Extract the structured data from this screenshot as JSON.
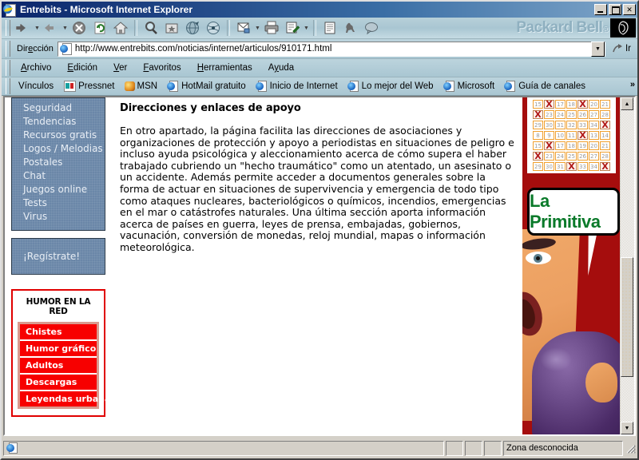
{
  "window": {
    "title": "Entrebits - Microsoft Internet Explorer",
    "app_icon": "ie-document-icon",
    "minimize_label": "",
    "maximize_label": "",
    "close_label": "✕"
  },
  "toolbar": {
    "buttons": [
      {
        "name": "back-button",
        "label": "Atrás",
        "icon": "arrow-left-icon"
      },
      {
        "name": "forward-button",
        "label": "Adelante",
        "icon": "arrow-right-icon"
      },
      {
        "name": "stop-button",
        "label": "Detener",
        "icon": "stop-icon"
      },
      {
        "name": "refresh-button",
        "label": "Actualizar",
        "icon": "refresh-icon"
      },
      {
        "name": "home-button",
        "label": "Inicio",
        "icon": "home-icon"
      },
      {
        "name": "search-button",
        "label": "Búsqueda",
        "icon": "magnifier-icon"
      },
      {
        "name": "favorites-button",
        "label": "Favoritos",
        "icon": "favorites-folder-icon"
      },
      {
        "name": "history-button",
        "label": "Historial",
        "icon": "history-globe-icon"
      },
      {
        "name": "channels-button",
        "label": "Canales",
        "icon": "channels-globe-icon"
      },
      {
        "name": "mail-button",
        "label": "Correo",
        "icon": "mail-icon"
      },
      {
        "name": "print-button",
        "label": "Imprimir",
        "icon": "printer-icon"
      },
      {
        "name": "edit-button",
        "label": "Modificar",
        "icon": "edit-page-icon"
      },
      {
        "name": "discuss-button",
        "label": "Discusión",
        "icon": "document-icon"
      },
      {
        "name": "messenger-button",
        "label": "Messenger",
        "icon": "kangaroo-icon"
      },
      {
        "name": "chat-button",
        "label": "Chat",
        "icon": "speech-bubble-icon"
      }
    ],
    "brand": "Packard Bell",
    "brand_mark": "®",
    "brand_logo": "packard-bell-head-logo"
  },
  "address": {
    "label_pre": "Dir",
    "label_accel": "e",
    "label_post": "cción",
    "url": "http://www.entrebits.com/noticias/internet/articulos/910171.html",
    "placeholder": "",
    "go_label": "Ir",
    "go_icon": "go-arrow-icon",
    "dropdown_icon": "chevron-down-icon",
    "page_icon": "ie-page-icon"
  },
  "menu": {
    "items": [
      {
        "pre": "",
        "accel": "A",
        "post": "rchivo"
      },
      {
        "pre": "",
        "accel": "E",
        "post": "dición"
      },
      {
        "pre": "",
        "accel": "V",
        "post": "er"
      },
      {
        "pre": "",
        "accel": "F",
        "post": "avoritos"
      },
      {
        "pre": "",
        "accel": "H",
        "post": "erramientas"
      },
      {
        "pre": "A",
        "accel": "y",
        "post": "uda"
      }
    ]
  },
  "links_bar": {
    "label": "Vínculos",
    "overflow": "»",
    "items": [
      {
        "label": "Pressnet",
        "icon": "pressnet-icon"
      },
      {
        "label": "MSN",
        "icon": "msn-butterfly-icon"
      },
      {
        "label": "HotMail gratuito",
        "icon": "ie-page-icon"
      },
      {
        "label": "Inicio de Internet",
        "icon": "ie-page-icon"
      },
      {
        "label": "Lo mejor del Web",
        "icon": "ie-page-icon"
      },
      {
        "label": "Microsoft",
        "icon": "ie-page-icon"
      },
      {
        "label": "Guía de canales",
        "icon": "ie-page-icon"
      }
    ]
  },
  "sidebar": {
    "nav_items": [
      {
        "label": "Seguridad"
      },
      {
        "label": "Tendencias"
      },
      {
        "label": "Recursos gratis"
      },
      {
        "label": "Logos / Melodias"
      },
      {
        "label": "Postales"
      },
      {
        "label": "Chat"
      },
      {
        "label": "Juegos online"
      },
      {
        "label": "Tests"
      },
      {
        "label": "Virus"
      }
    ],
    "register_label": "¡Regístrate!",
    "humor_box": {
      "title": "HUMOR EN LA RED",
      "items": [
        {
          "label": "Chistes"
        },
        {
          "label": "Humor gráfico"
        },
        {
          "label": "Adultos"
        },
        {
          "label": "Descargas"
        },
        {
          "label": "Leyendas urbanas"
        }
      ]
    },
    "colors": {
      "nav_background": "#6b87a8",
      "humor_red": "#f70000",
      "humor_border": "#e00000"
    }
  },
  "article": {
    "heading": "Direcciones y enlaces de apoyo",
    "body": "En otro apartado, la página facilita las direcciones de asociaciones y organizaciones de protección y apoyo a periodistas en situaciones de peligro e incluso ayuda psicológica y aleccionamiento acerca de cómo supera el haber trabajado cubriendo un \"hecho traumático\" como un atentado, un asesinato o un accidente. Además permite acceder a documentos generales sobre la forma de actuar en situaciones de supervivencia y emergencia de todo tipo como ataques nucleares, bacteriológicos o químicos, incendios, emergencias en el mar o catástrofes naturales. Una última sección aporta información acerca de países en guerra, leyes de prensa, embajadas, gobiernos, vacunación, conversión de monedas, reloj mundial, mapas o información meteorológica."
  },
  "advert": {
    "brand": "La Primitiva",
    "background_color": "#a50d0d",
    "brand_color": "#0a7a2a",
    "image_alt": "woman-shouting-photo",
    "lottery_grid": [
      [
        "15",
        "X",
        "17",
        "18",
        "X",
        "20",
        "21"
      ],
      [
        "X",
        "23",
        "24",
        "25",
        "26",
        "27",
        "28"
      ],
      [
        "29",
        "30",
        "31",
        "32",
        "33",
        "34",
        "X"
      ],
      [
        "8",
        "9",
        "10",
        "11",
        "X",
        "13",
        "14"
      ],
      [
        "15",
        "X",
        "17",
        "18",
        "19",
        "20",
        "21"
      ],
      [
        "X",
        "23",
        "24",
        "25",
        "26",
        "27",
        "28"
      ],
      [
        "29",
        "30",
        "31",
        "X",
        "33",
        "34",
        "X"
      ]
    ]
  },
  "scrollbar": {
    "up_icon": "▲",
    "down_icon": "▼"
  },
  "statusbar": {
    "message": "",
    "zone": "Zona desconocida",
    "zone_icon": "ie-page-icon"
  }
}
